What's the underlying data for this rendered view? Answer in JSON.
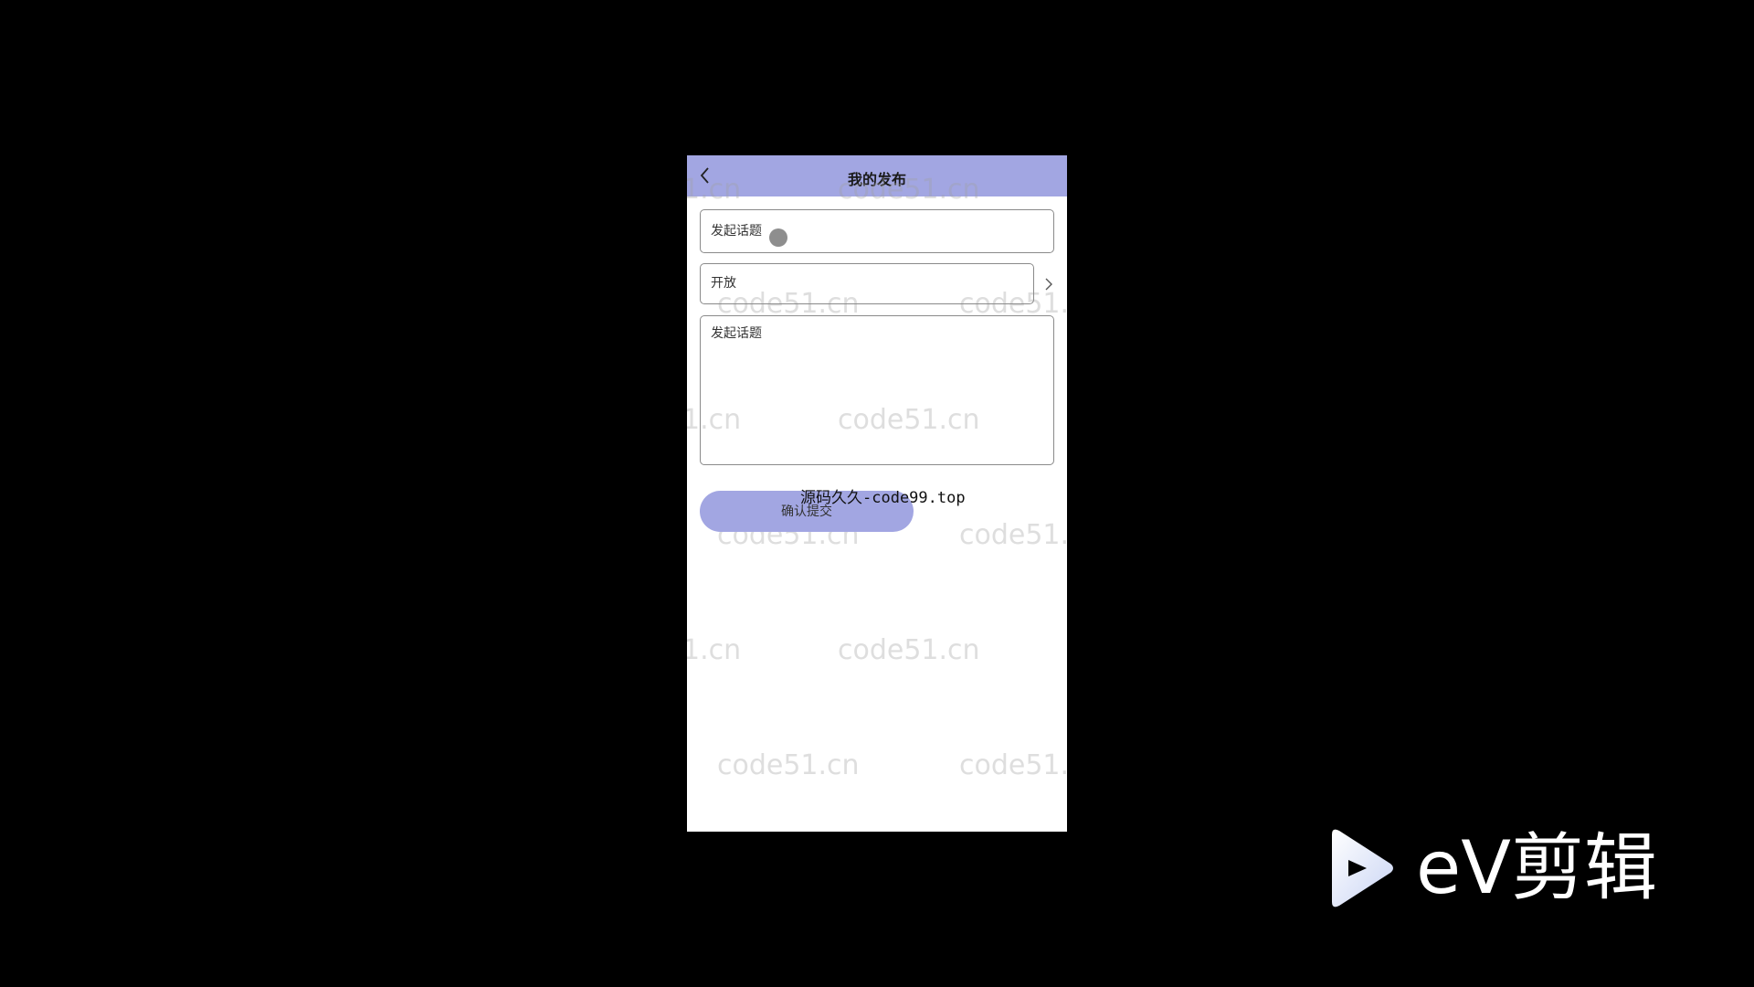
{
  "header": {
    "title": "我的发布",
    "back_icon": "chevron-left-icon",
    "background": "#a2a6e2"
  },
  "form": {
    "title_placeholder": "发起话题",
    "visibility_value": "开放",
    "visibility_icon": "chevron-right-icon",
    "content_placeholder": "发起话题",
    "submit_label": "确认提交"
  },
  "overlay": {
    "text": "源码久久-code99.top"
  },
  "watermark": {
    "text": "code51.cn",
    "partial_text": "1.cn"
  },
  "logo": {
    "text": "eV剪辑"
  }
}
